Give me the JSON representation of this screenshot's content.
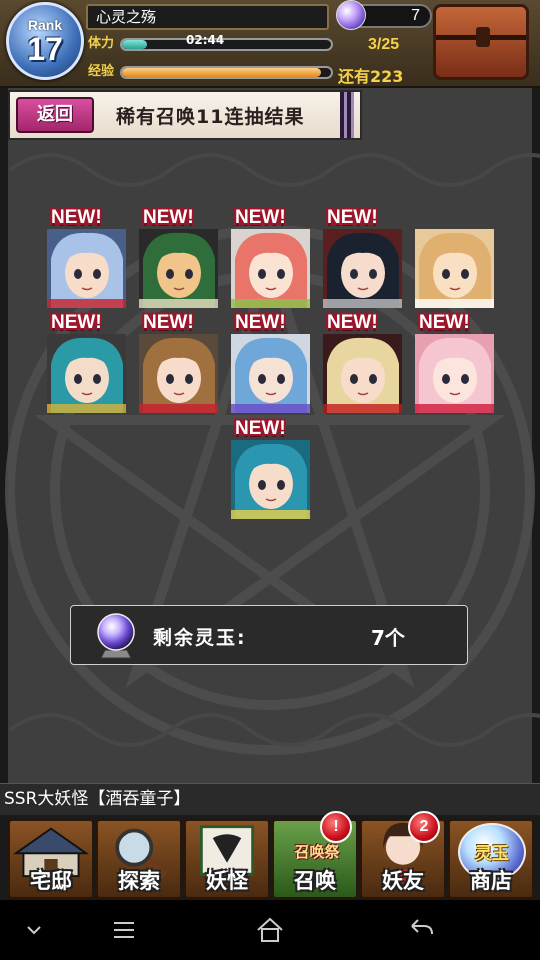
{
  "hud": {
    "rank_label": "Rank",
    "rank_value": "17",
    "player_name": "心灵之殇",
    "stamina_label": "体力",
    "stamina_timer": "02:44",
    "stamina_count": "3/25",
    "stamina_fraction": 0.12,
    "exp_label": "经验",
    "exp_remaining": "还有223",
    "exp_fraction": 0.95,
    "gem_count": "7"
  },
  "banner": {
    "back_label": "返回",
    "title": "稀有召唤11连抽结果"
  },
  "results": {
    "new_label": "NEW!",
    "cards": [
      {
        "is_new": true,
        "hair": "#a9c2e8",
        "skin": "#f7dcc9",
        "bg": "#4a5e8a",
        "accent": "#c8202a"
      },
      {
        "is_new": true,
        "hair": "#2f6e3a",
        "skin": "#f1c48a",
        "bg": "#2a2a2a",
        "accent": "#e8e0c0"
      },
      {
        "is_new": true,
        "hair": "#e8746a",
        "skin": "#fbe3d3",
        "bg": "#d9d4cf",
        "accent": "#8ac24a"
      },
      {
        "is_new": true,
        "hair": "#1a2230",
        "skin": "#f5dccc",
        "bg": "#5a2020",
        "accent": "#c0c0c0"
      },
      {
        "is_new": false,
        "hair": "#e0b070",
        "skin": "#f9e0c3",
        "bg": "#e8c99a",
        "accent": "#ffffff"
      },
      {
        "is_new": true,
        "hair": "#2a9aa6",
        "skin": "#f3dcc8",
        "bg": "#3a3a3a",
        "accent": "#d6b23a"
      },
      {
        "is_new": true,
        "hair": "#a0703e",
        "skin": "#f7dccb",
        "bg": "#5a4a3a",
        "accent": "#c82030"
      },
      {
        "is_new": true,
        "hair": "#6fa8d8",
        "skin": "#f6e2d5",
        "bg": "#cfd8e2",
        "accent": "#6a4ac8"
      },
      {
        "is_new": true,
        "hair": "#e8d6a0",
        "skin": "#f7dcc9",
        "bg": "#3a1a1a",
        "accent": "#c01a1a"
      },
      {
        "is_new": true,
        "hair": "#f6c6d0",
        "skin": "#fbe5dc",
        "bg": "#e8a0b0",
        "accent": "#d01a3a"
      },
      {
        "is_new": true,
        "hair": "#2a96b0",
        "skin": "#f5ddc9",
        "bg": "#1a6a80",
        "accent": "#e8d04a"
      }
    ]
  },
  "remaining": {
    "label": "剩余灵玉:",
    "value": "7个"
  },
  "ticker": {
    "text": "SSR大妖怪【酒吞童子】"
  },
  "nav": {
    "items": [
      {
        "label": "宅邸",
        "badge": ""
      },
      {
        "label": "探索",
        "badge": ""
      },
      {
        "label": "妖怪",
        "badge": ""
      },
      {
        "label": "召唤",
        "badge": "!",
        "event_tag": "召唤祭"
      },
      {
        "label": "妖友",
        "badge": "2"
      },
      {
        "label": "商店",
        "badge": "",
        "orb_label": "灵玉"
      }
    ]
  },
  "colors": {
    "new_outline": "#a0142a",
    "back_button": "#c23585",
    "stamina_fill": "#4cc4b4",
    "exp_fill": "#f0a030",
    "hud_gold": "#f6d24a"
  },
  "system": {
    "icons": [
      "chevron-down-icon",
      "menu-icon",
      "home-icon",
      "back-arrow-icon"
    ]
  }
}
